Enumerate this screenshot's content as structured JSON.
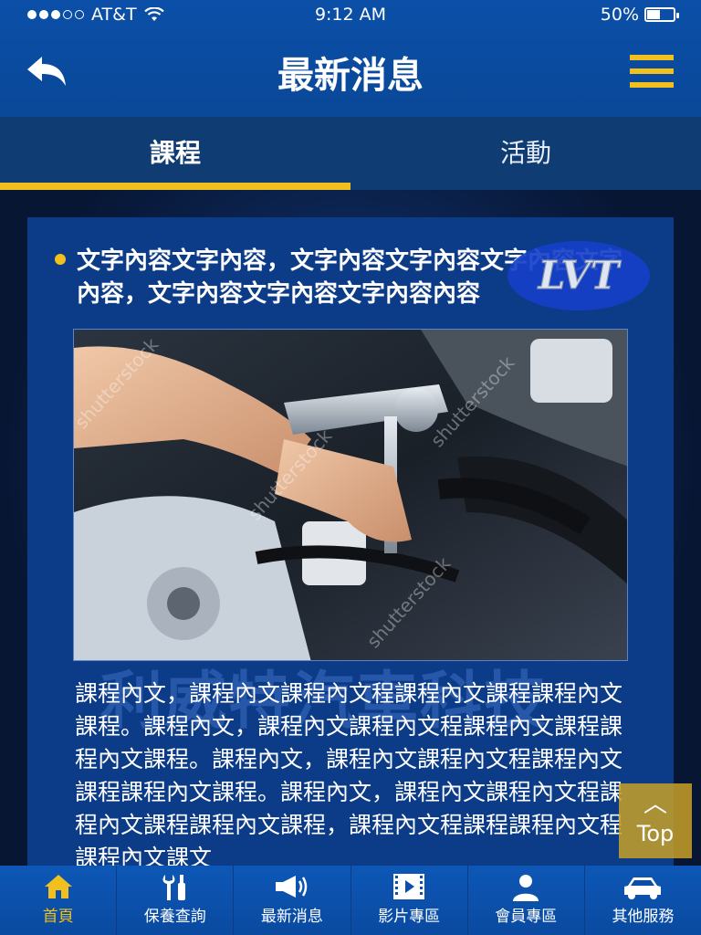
{
  "status_bar": {
    "carrier": "AT&T",
    "time": "9:12 AM",
    "battery": "50%",
    "battery_level": 0.5
  },
  "header": {
    "title": "最新消息"
  },
  "tabs": [
    {
      "label": "課程",
      "active": true
    },
    {
      "label": "活動",
      "active": false
    }
  ],
  "article": {
    "headline": "文字內容文字內容，文字內容文字內容文字內容文字內容，文字內容文字內容文字內容內容",
    "badge_text": "LVT",
    "watermark_text": "利威特汽車科技",
    "photo_watermark": "shutterstock",
    "body": "課程內文，課程內文課程內文程課程內文課程課程內文課程。課程內文，課程內文課程內文程課程內文課程課程內文課程。課程內文，課程內文課程內文程課程內文課程課程內文課程。課程內文，課程內文課程內文程課程內文課程課程內文課程，課程內文程課程課程內文程課程內文課文"
  },
  "top_button": {
    "arrow": "︿",
    "label": "Top"
  },
  "bottom_nav": [
    {
      "label": "首頁",
      "icon": "home-icon",
      "active": true
    },
    {
      "label": "保養查詢",
      "icon": "tools-icon",
      "active": false
    },
    {
      "label": "最新消息",
      "icon": "megaphone-icon",
      "active": false
    },
    {
      "label": "影片專區",
      "icon": "film-icon",
      "active": false
    },
    {
      "label": "會員專區",
      "icon": "user-icon",
      "active": false
    },
    {
      "label": "其他服務",
      "icon": "car-icon",
      "active": false
    }
  ],
  "colors": {
    "primary_blue": "#0b4fa8",
    "accent_yellow": "#f2c01e",
    "tab_bar": "#0f3c73",
    "panel": "#0c3c88"
  }
}
